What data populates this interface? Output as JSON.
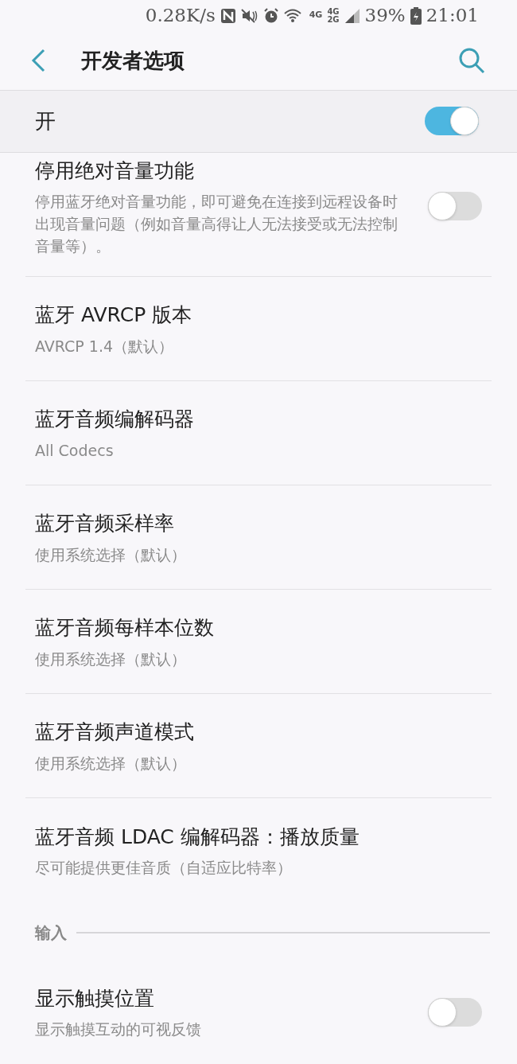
{
  "status_bar": {
    "speed": "0.28K/s",
    "network_labels": [
      "4G",
      "4G",
      "2G"
    ],
    "battery": "39%",
    "time": "21:01"
  },
  "header": {
    "title": "开发者选项"
  },
  "master": {
    "label": "开",
    "on": true
  },
  "items": [
    {
      "kind": "toggle",
      "title": "停用绝对音量功能",
      "subtitle": "停用蓝牙绝对音量功能，即可避免在连接到远程设备时出现音量问题（例如音量高得让人无法接受或无法控制音量等）。",
      "on": false
    },
    {
      "kind": "value",
      "title": "蓝牙 AVRCP 版本",
      "subtitle": "AVRCP 1.4（默认）"
    },
    {
      "kind": "value",
      "title": "蓝牙音频编解码器",
      "subtitle": "All Codecs"
    },
    {
      "kind": "value",
      "title": "蓝牙音频采样率",
      "subtitle": "使用系统选择（默认）"
    },
    {
      "kind": "value",
      "title": "蓝牙音频每样本位数",
      "subtitle": "使用系统选择（默认）"
    },
    {
      "kind": "value",
      "title": "蓝牙音频声道模式",
      "subtitle": "使用系统选择（默认）"
    },
    {
      "kind": "value",
      "title": "蓝牙音频 LDAC 编解码器：播放质量",
      "subtitle": "尽可能提供更佳音质（自适应比特率）"
    },
    {
      "kind": "section",
      "title": "输入"
    },
    {
      "kind": "toggle",
      "title": "显示触摸位置",
      "subtitle": "显示触摸互动的可视反馈",
      "on": false
    }
  ]
}
